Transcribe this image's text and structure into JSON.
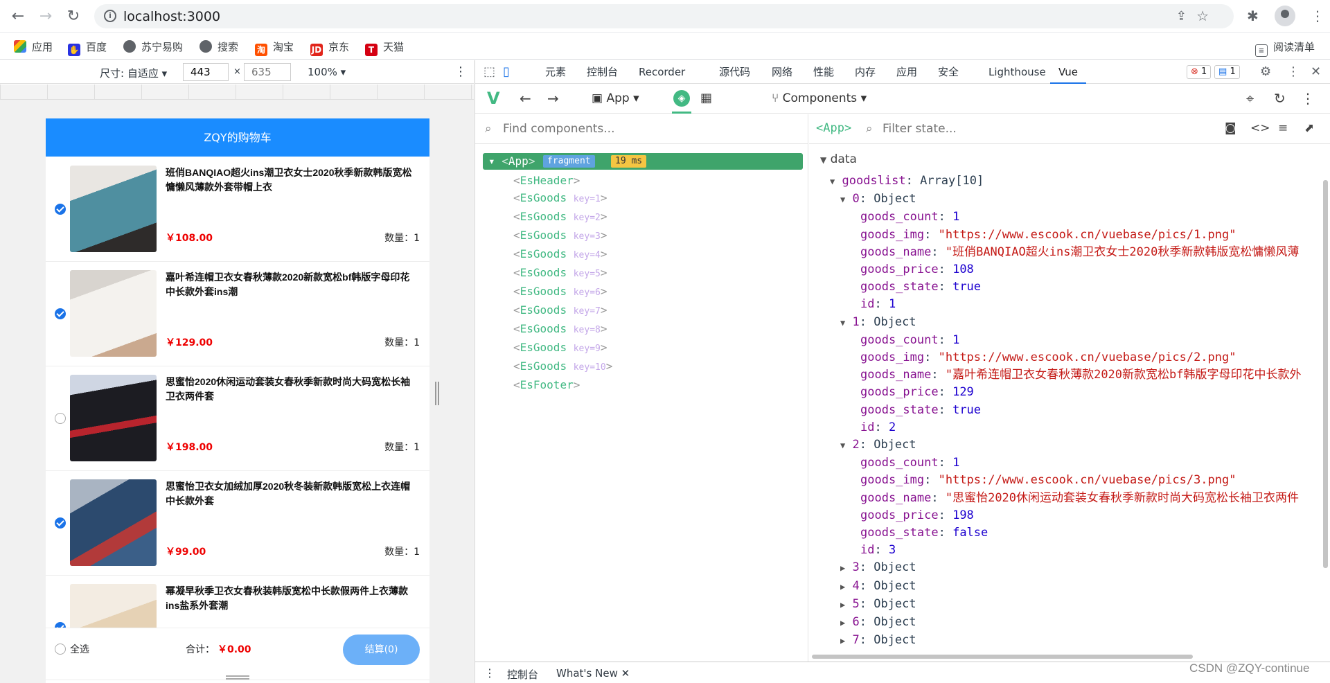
{
  "browser": {
    "url": "localhost:3000",
    "bookmarks": [
      "应用",
      "百度",
      "苏宁易购",
      "搜索",
      "淘宝",
      "京东",
      "天猫"
    ],
    "reading_list": "阅读清单"
  },
  "device_toolbar": {
    "size_label": "尺寸: 自适应",
    "width": "443",
    "height_placeholder": "635",
    "zoom": "100%"
  },
  "app": {
    "header_title": "ZQY的购物车",
    "goods": [
      {
        "name": "班俏BANQIAO超火ins潮卫衣女士2020秋季新款韩版宽松慵懒风薄款外套带帽上衣",
        "price": "￥108.00",
        "count": "数量：1",
        "checked": true
      },
      {
        "name": "嘉叶希连帽卫衣女春秋薄款2020新款宽松bf韩版字母印花中长款外套ins潮",
        "price": "￥129.00",
        "count": "数量：1",
        "checked": true
      },
      {
        "name": "思蜜怡2020休闲运动套装女春秋季新款时尚大码宽松长袖卫衣两件套",
        "price": "￥198.00",
        "count": "数量：1",
        "checked": false
      },
      {
        "name": "思蜜怡卫衣女加绒加厚2020秋冬装新款韩版宽松上衣连帽中长款外套",
        "price": "￥99.00",
        "count": "数量：1",
        "checked": true
      },
      {
        "name": "幂凝早秋季卫衣女春秋装韩版宽松中长款假两件上衣薄款ins盐系外套潮",
        "price": "",
        "count": "",
        "checked": true
      }
    ],
    "footer": {
      "select_all": "全选",
      "total_label": "合计：",
      "total_value": "￥0.00",
      "checkout": "结算(0)"
    }
  },
  "devtools": {
    "tabs": [
      "元素",
      "控制台",
      "Recorder",
      "源代码",
      "网络",
      "性能",
      "内存",
      "应用",
      "安全",
      "Lighthouse",
      "Vue"
    ],
    "errors": "1",
    "messages": "1",
    "vue_app_label": "App",
    "components_label": "Components",
    "find_placeholder": "Find components...",
    "filter_placeholder": "Filter state...",
    "selected_tag": "<App>",
    "tree": {
      "root": "App",
      "fragment": "fragment",
      "time": "19 ms",
      "header": "EsHeader",
      "goods_items": [
        "key=1",
        "key=2",
        "key=3",
        "key=4",
        "key=5",
        "key=6",
        "key=7",
        "key=8",
        "key=9",
        "key=10"
      ],
      "goods_tag": "EsGoods",
      "footer": "EsFooter"
    },
    "state": {
      "section": "data",
      "goodslist_key": "goodslist",
      "goodslist_type": "Array[10]",
      "objects": [
        {
          "index": "0",
          "count": "1",
          "img": "\"https://www.escook.cn/vuebase/pics/1.png\"",
          "name": "\"班俏BANQIAO超火ins潮卫衣女士2020秋季新款韩版宽松慵懒风薄",
          "price": "108",
          "state": "true",
          "id": "1"
        },
        {
          "index": "1",
          "count": "1",
          "img": "\"https://www.escook.cn/vuebase/pics/2.png\"",
          "name": "\"嘉叶希连帽卫衣女春秋薄款2020新款宽松bf韩版字母印花中长款外",
          "price": "129",
          "state": "true",
          "id": "2"
        },
        {
          "index": "2",
          "count": "1",
          "img": "\"https://www.escook.cn/vuebase/pics/3.png\"",
          "name": "\"思蜜怡2020休闲运动套装女春秋季新款时尚大码宽松长袖卫衣两件",
          "price": "198",
          "state": "false",
          "id": "3"
        }
      ],
      "collapsed": [
        "3",
        "4",
        "5",
        "6",
        "7"
      ],
      "object_label": "Object",
      "field_count": "goods_count",
      "field_img": "goods_img",
      "field_name": "goods_name",
      "field_price": "goods_price",
      "field_state": "goods_state",
      "field_id": "id"
    },
    "drawer": {
      "console": "控制台",
      "whats_new": "What's New"
    }
  },
  "watermark": "CSDN @ZQY-continue"
}
